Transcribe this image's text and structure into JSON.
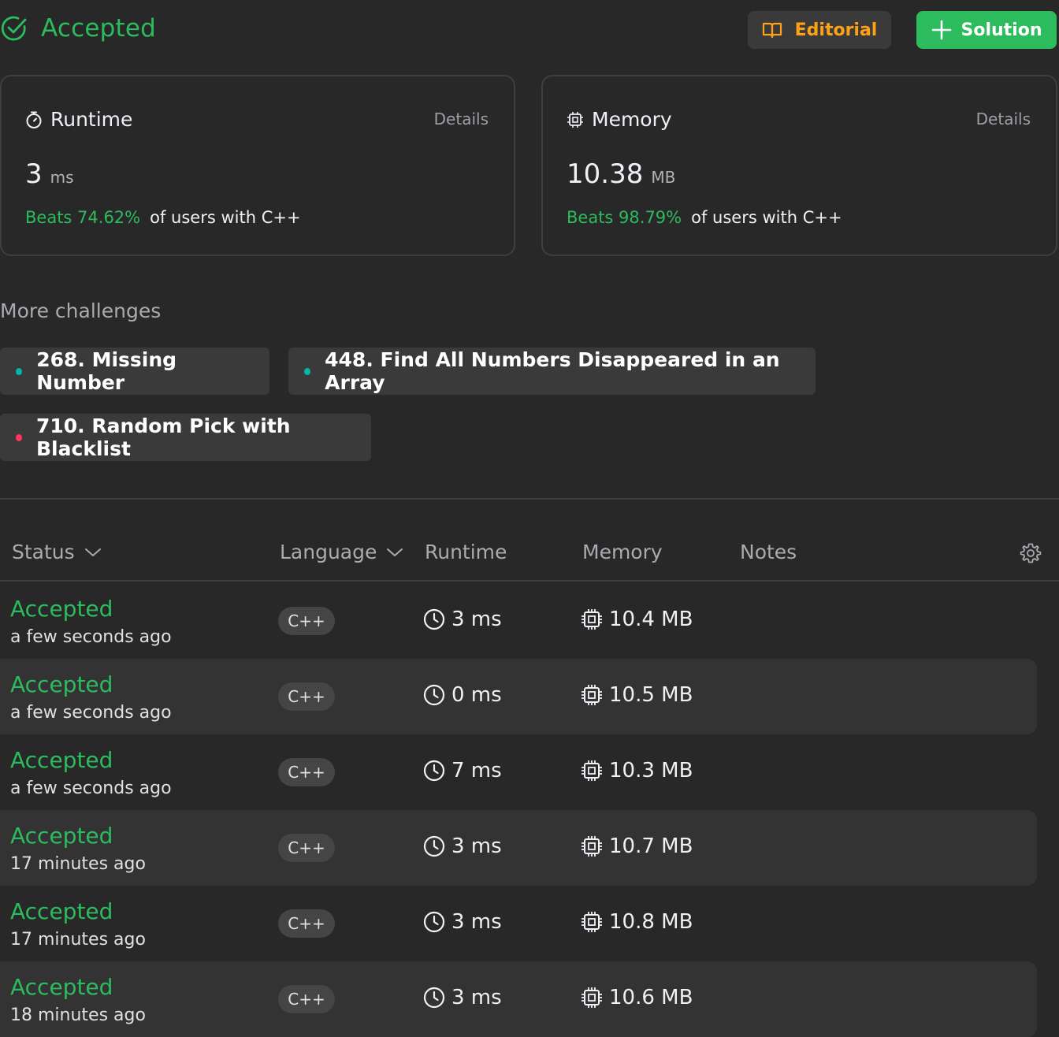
{
  "header": {
    "status": "Accepted",
    "editorial_label": "Editorial",
    "solution_label": "Solution"
  },
  "runtime_card": {
    "title": "Runtime",
    "details": "Details",
    "value": "3",
    "unit": "ms",
    "beats": "Beats 74.62%",
    "suffix": "of users with C++"
  },
  "memory_card": {
    "title": "Memory",
    "details": "Details",
    "value": "10.38",
    "unit": "MB",
    "beats": "Beats 98.79%",
    "suffix": "of users with C++"
  },
  "more_challenges": {
    "title": "More challenges",
    "items": [
      {
        "label": "268. Missing Number",
        "difficulty_color": "#00b8a3"
      },
      {
        "label": "448. Find All Numbers Disappeared in an Array",
        "difficulty_color": "#00b8a3"
      },
      {
        "label": "710. Random Pick with Blacklist",
        "difficulty_color": "#ff375f"
      }
    ]
  },
  "table": {
    "headers": {
      "status": "Status",
      "language": "Language",
      "runtime": "Runtime",
      "memory": "Memory",
      "notes": "Notes"
    },
    "rows": [
      {
        "status": "Accepted",
        "time": "a few seconds ago",
        "language": "C++",
        "runtime": "3 ms",
        "memory": "10.4 MB"
      },
      {
        "status": "Accepted",
        "time": "a few seconds ago",
        "language": "C++",
        "runtime": "0 ms",
        "memory": "10.5 MB"
      },
      {
        "status": "Accepted",
        "time": "a few seconds ago",
        "language": "C++",
        "runtime": "7 ms",
        "memory": "10.3 MB"
      },
      {
        "status": "Accepted",
        "time": "17 minutes ago",
        "language": "C++",
        "runtime": "3 ms",
        "memory": "10.7 MB"
      },
      {
        "status": "Accepted",
        "time": "17 minutes ago",
        "language": "C++",
        "runtime": "3 ms",
        "memory": "10.8 MB"
      },
      {
        "status": "Accepted",
        "time": "18 minutes ago",
        "language": "C++",
        "runtime": "3 ms",
        "memory": "10.6 MB"
      }
    ]
  },
  "colors": {
    "accent_green": "#2cbb5d",
    "editorial_orange": "#ffa116",
    "easy": "#00b8a3",
    "hard": "#ff375f"
  },
  "icons": {
    "status": "check-circle-icon",
    "editorial": "book-open-icon",
    "solution": "plus-icon",
    "runtime": "stopwatch-icon",
    "memory": "chip-icon",
    "clock": "clock-icon",
    "settings": "gear-icon",
    "dropdown": "chevron-down-icon"
  }
}
